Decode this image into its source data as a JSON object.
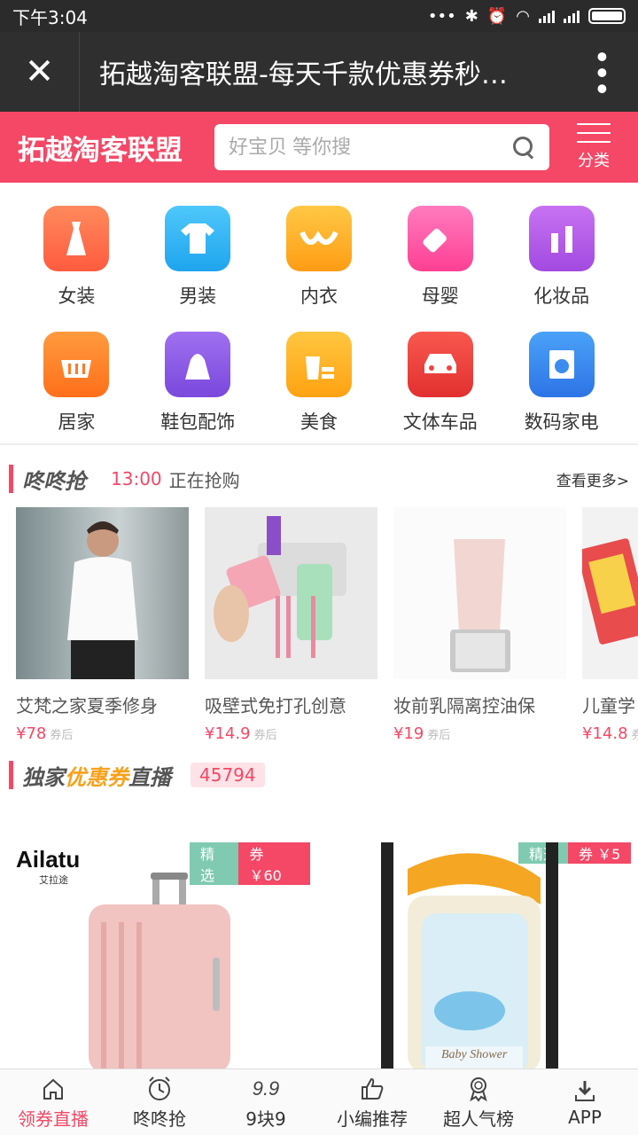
{
  "status_bar": {
    "time": "下午3:04"
  },
  "title_bar": {
    "title": "拓越淘客联盟-每天千款优惠券秒…"
  },
  "header": {
    "brand": "拓越淘客联盟",
    "search_placeholder": "好宝贝 等你搜",
    "category_label": "分类",
    "accent_color": "#f44866"
  },
  "categories": [
    {
      "label": "女装",
      "icon": "dress-icon",
      "color": "#ff6a4d"
    },
    {
      "label": "男装",
      "icon": "shirt-icon",
      "color": "#2fb4f5"
    },
    {
      "label": "内衣",
      "icon": "bra-icon",
      "color": "#ffb21e"
    },
    {
      "label": "母婴",
      "icon": "baby-bottle-icon",
      "color": "#ff5ca8"
    },
    {
      "label": "化妆品",
      "icon": "cosmetics-icon",
      "color": "#b65ae8"
    },
    {
      "label": "居家",
      "icon": "basket-icon",
      "color": "#ff7a28"
    },
    {
      "label": "鞋包配饰",
      "icon": "bag-shoe-icon",
      "color": "#8b5ae6"
    },
    {
      "label": "美食",
      "icon": "food-icon",
      "color": "#ffb51c"
    },
    {
      "label": "文体车品",
      "icon": "car-icon",
      "color": "#f2433e"
    },
    {
      "label": "数码家电",
      "icon": "appliance-icon",
      "color": "#3b8cf0"
    }
  ],
  "flash_sale": {
    "title": "咚咚抢",
    "time": "13:00",
    "status": "正在抢购",
    "more": "查看更多>",
    "items": [
      {
        "name": "艾梵之家夏季修身",
        "price": "¥78",
        "tag": "券后"
      },
      {
        "name": "吸壁式免打孔创意",
        "price": "¥14.9",
        "tag": "券后"
      },
      {
        "name": "妆前乳隔离控油保",
        "price": "¥19",
        "tag": "券后"
      },
      {
        "name": "儿童学",
        "price": "¥14.8",
        "tag": "券后"
      }
    ]
  },
  "coupon_section": {
    "title_a": "独家",
    "title_b": "优惠券",
    "title_c": "直播",
    "count": "45794",
    "items": [
      {
        "badge_select": "精选",
        "badge_coupon": "券 ￥60",
        "brand_text": "Ailatu",
        "brand_sub": "艾拉途"
      },
      {
        "badge_select": "精选",
        "badge_coupon": "券 ￥5",
        "brand_text": "Baby Shower"
      }
    ]
  },
  "bottom_nav": [
    {
      "label": "领券直播",
      "icon": "home-icon",
      "active": true
    },
    {
      "label": "咚咚抢",
      "icon": "alarm-clock-icon",
      "active": false
    },
    {
      "label": "9块9",
      "icon": "nine-nine-icon",
      "active": false
    },
    {
      "label": "小编推荐",
      "icon": "thumbs-up-icon",
      "active": false
    },
    {
      "label": "超人气榜",
      "icon": "medal-icon",
      "active": false
    },
    {
      "label": "APP",
      "icon": "download-icon",
      "active": false
    }
  ]
}
